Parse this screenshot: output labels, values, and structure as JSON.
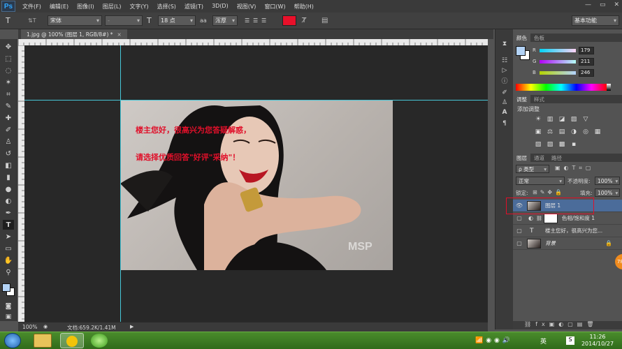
{
  "app": {
    "logo": "Ps"
  },
  "menu": [
    "文件(F)",
    "编辑(E)",
    "图像(I)",
    "图层(L)",
    "文字(Y)",
    "选择(S)",
    "滤镜(T)",
    "3D(D)",
    "视图(V)",
    "窗口(W)",
    "帮助(H)"
  ],
  "window_controls": {
    "minimize": "—",
    "maximize": "▭",
    "close": "✕"
  },
  "options": {
    "tool_icon": "T",
    "orient_icon": "⇅T",
    "font_family": "宋体",
    "font_style": "-",
    "size_icon": "T",
    "font_size": "18 点",
    "aa_icon": "aa",
    "antialias": "浑厚",
    "text_color": "#e8102a",
    "workspace": "基本功能"
  },
  "document": {
    "tab_title": "1.jpg @ 100% (图层 1, RGB/8#) *",
    "close": "×",
    "overlay_line1": "楼主您好，很高兴为您答疑解惑，",
    "overlay_line2": "请选择优质回答\"好评\"采纳\"！",
    "watermark": "MSP",
    "ruler_top": [
      "0",
      "5",
      "0",
      "5",
      "10",
      "15"
    ],
    "ruler_left": [
      "4",
      "2",
      "0",
      "2",
      "4",
      "6",
      "8",
      "10",
      "12",
      "14",
      "16",
      "18"
    ]
  },
  "status": {
    "zoom": "100%",
    "doc_info": "文档:659.2K/1.41M"
  },
  "color_panel": {
    "tabs": [
      "颜色",
      "色板"
    ],
    "channels": [
      {
        "label": "R",
        "value": "179"
      },
      {
        "label": "G",
        "value": "211"
      },
      {
        "label": "B",
        "value": "246"
      }
    ],
    "fg_color": "#b3d3f6"
  },
  "adjust_panel": {
    "tabs": [
      "调整",
      "样式"
    ],
    "title": "添加调整"
  },
  "layers_panel": {
    "tabs": [
      "图层",
      "通道",
      "路径"
    ],
    "kind_filter": "ρ 类型",
    "blend_mode": "正常",
    "opacity_label": "不透明度:",
    "opacity": "100%",
    "lock_label": "锁定:",
    "fill_label": "填充:",
    "fill": "100%",
    "layers": [
      {
        "name": "图层 1",
        "visible": true,
        "selected": true
      },
      {
        "name": "色相/饱和度 1",
        "visible": false,
        "selected": false
      },
      {
        "name": "楼主您好，很高兴为您...",
        "visible": false,
        "selected": false
      },
      {
        "name": "背景",
        "visible": false,
        "selected": false
      }
    ],
    "badge": "78"
  },
  "taskbar": {
    "ime": "英",
    "time": "11:26",
    "date": "2014/10/27"
  }
}
